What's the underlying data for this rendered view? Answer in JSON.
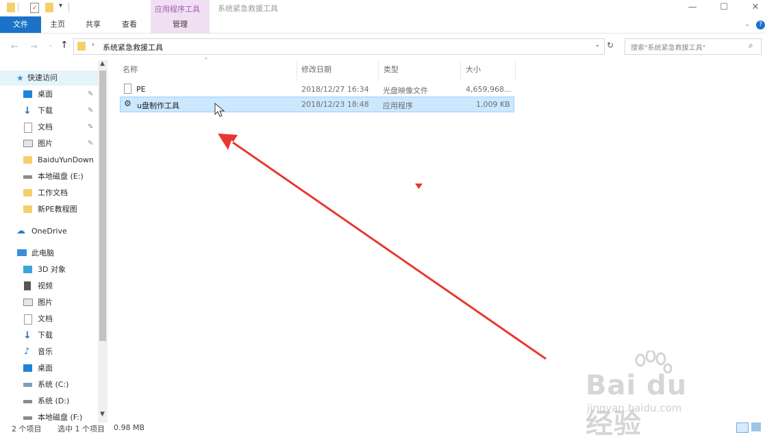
{
  "titlebar": {
    "context_tab_group": "应用程序工具",
    "window_title": "系统紧急救援工具"
  },
  "ribbon": {
    "tabs": [
      "文件",
      "主页",
      "共享",
      "查看",
      "管理"
    ]
  },
  "address": {
    "path_segment": "系统紧急救援工具",
    "search_placeholder": "搜索\"系统紧急救援工具\""
  },
  "sidebar": {
    "quick_access": "快速访问",
    "quick_items": [
      {
        "label": "桌面",
        "pinned": true
      },
      {
        "label": "下载",
        "pinned": true
      },
      {
        "label": "文档",
        "pinned": true
      },
      {
        "label": "图片",
        "pinned": true
      },
      {
        "label": "BaiduYunDown"
      },
      {
        "label": "本地磁盘 (E:)"
      },
      {
        "label": "工作文档"
      },
      {
        "label": "新PE教程图"
      }
    ],
    "onedrive": "OneDrive",
    "this_pc": "此电脑",
    "pc_items": [
      "3D 对象",
      "视频",
      "图片",
      "文档",
      "下载",
      "音乐",
      "桌面",
      "系统 (C:)",
      "系统 (D:)",
      "本地磁盘 (F:)"
    ]
  },
  "columns": {
    "name": "名称",
    "date": "修改日期",
    "type": "类型",
    "size": "大小"
  },
  "files": [
    {
      "name": "PE",
      "date": "2018/12/27 16:34",
      "type": "光盘映像文件",
      "size": "4,659,968...",
      "selected": false
    },
    {
      "name": "u盘制作工具",
      "date": "2018/12/23 18:48",
      "type": "应用程序",
      "size": "1,009 KB",
      "selected": true
    }
  ],
  "status": {
    "count": "2 个项目",
    "selected": "选中 1 个项目",
    "size": "0.98 MB"
  },
  "watermark": {
    "logo": "Bai du 经验",
    "url": "jingyan.baidu.com"
  },
  "colors": {
    "accent": "#1a73c9",
    "context_tab": "#f1dff3",
    "selection": "#cce8ff",
    "annotation_arrow": "#e8372f"
  }
}
